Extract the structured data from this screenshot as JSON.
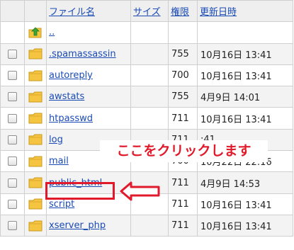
{
  "header": {
    "name": "ファイル名",
    "size": "サイズ",
    "permission": "権限",
    "updated": "更新日時"
  },
  "parent_row": {
    "label": ".."
  },
  "rows": [
    {
      "name": ".spamassassin",
      "permission": "755",
      "updated": "10月16日 13:41"
    },
    {
      "name": "autoreply",
      "permission": "700",
      "updated": "10月16日 13:41"
    },
    {
      "name": "awstats",
      "permission": "755",
      "updated": "4月9日 14:01"
    },
    {
      "name": "htpasswd",
      "permission": "711",
      "updated": "10月16日 13:41"
    },
    {
      "name": "log",
      "permission": "711",
      "updated": ":41"
    },
    {
      "name": "mail",
      "permission": "700",
      "updated": "10月22日 22:16"
    },
    {
      "name": "public_html",
      "permission": "711",
      "updated": "4月9日 14:53"
    },
    {
      "name": "script",
      "permission": "711",
      "updated": "10月16日 13:41"
    },
    {
      "name": "xserver_php",
      "permission": "711",
      "updated": "10月16日 13:41"
    }
  ],
  "annotation": {
    "callout_text": "ここをクリックします",
    "color": "#e0192b"
  },
  "colors": {
    "link": "#1a4bb5",
    "folder": "#f5c542",
    "up_arrow": "#3aa537"
  }
}
